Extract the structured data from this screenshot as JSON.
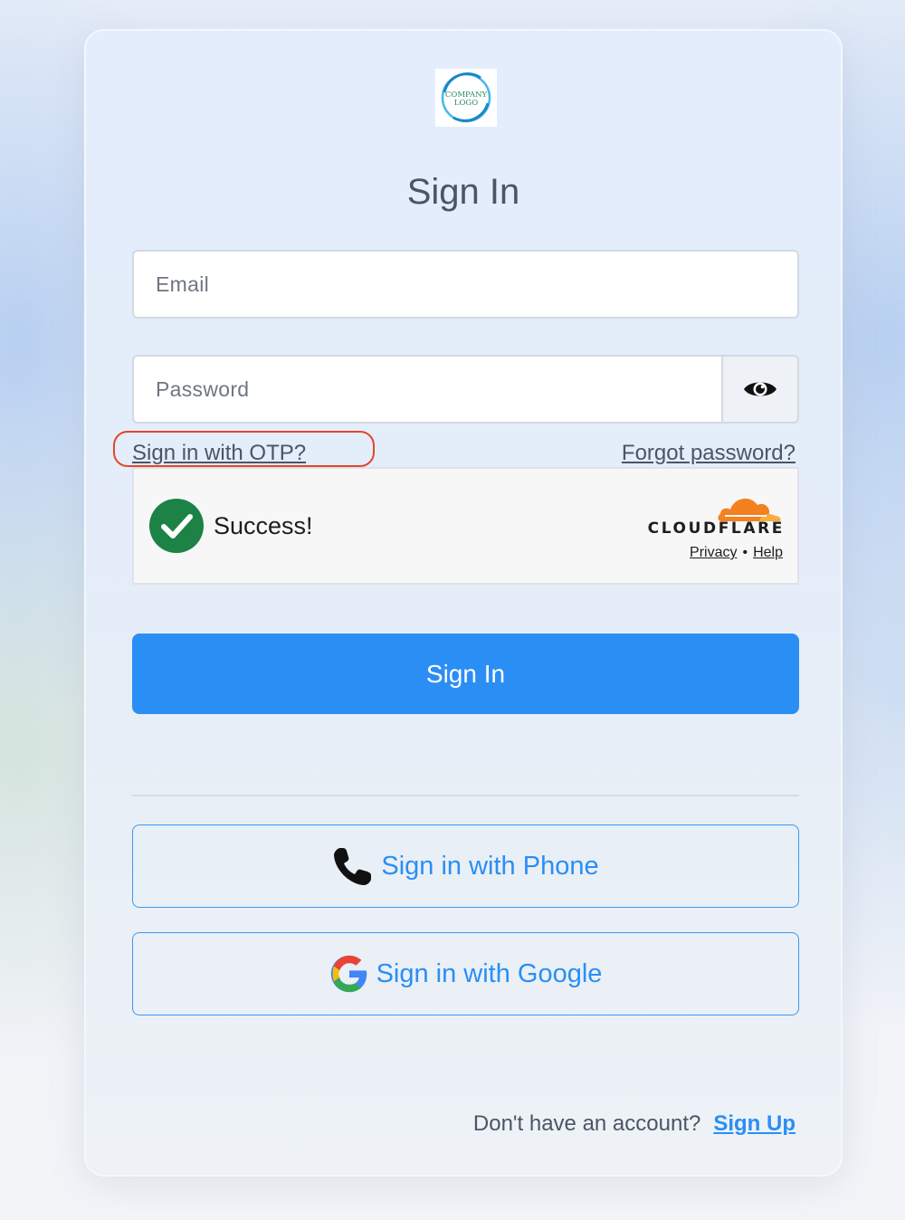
{
  "logo": {
    "text_line1": "COMPANY",
    "text_line2": "LOGO",
    "icon": "company-logo"
  },
  "title": "Sign In",
  "email": {
    "placeholder": "Email",
    "value": ""
  },
  "password": {
    "placeholder": "Password",
    "value": "",
    "toggle_icon": "eye-icon"
  },
  "links": {
    "otp": "Sign in with OTP?",
    "forgot": "Forgot password?"
  },
  "captcha": {
    "status": "Success!",
    "status_icon": "check-circle-icon",
    "provider": "CLOUDFLARE",
    "privacy": "Privacy",
    "separator": "•",
    "help": "Help"
  },
  "sign_in_button": "Sign In",
  "social": {
    "phone": {
      "label": "Sign in with Phone",
      "icon": "phone-icon"
    },
    "google": {
      "label": "Sign in with Google",
      "icon": "google-icon"
    }
  },
  "footer": {
    "prompt": "Don't have an account?",
    "signup": "Sign Up"
  },
  "colors": {
    "primary": "#2a8ef5",
    "highlight": "#e4462a",
    "success": "#1d8245",
    "cloudflare": "#f48120"
  }
}
